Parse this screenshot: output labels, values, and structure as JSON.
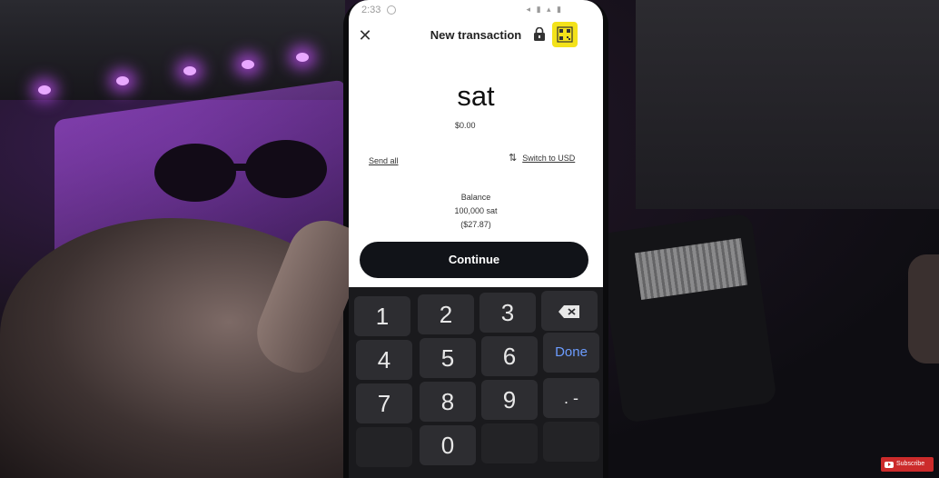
{
  "status_bar": {
    "time": "2:33"
  },
  "header": {
    "title": "New transaction",
    "close_icon": "close-icon",
    "lock_icon": "lock-icon",
    "qr_icon": "qr-code-icon"
  },
  "amount": {
    "unit": "sat",
    "fiat": "$0.00"
  },
  "actions": {
    "send_all": "Send all",
    "switch_label": "Switch to USD"
  },
  "balance": {
    "label": "Balance",
    "sat": "100,000 sat",
    "usd": "($27.87)"
  },
  "continue_label": "Continue",
  "keypad": {
    "k1": "1",
    "k2": "2",
    "k3": "3",
    "k4": "4",
    "k5": "5",
    "k6": "6",
    "k7": "7",
    "k8": "8",
    "k9": "9",
    "k0": "0",
    "sym": ". -",
    "done": "Done"
  },
  "overlay": {
    "subscribe": "Subscribe"
  },
  "colors": {
    "qr_highlight": "#f3e21a",
    "done_blue": "#6c9cff",
    "continue_bg": "#111318"
  }
}
